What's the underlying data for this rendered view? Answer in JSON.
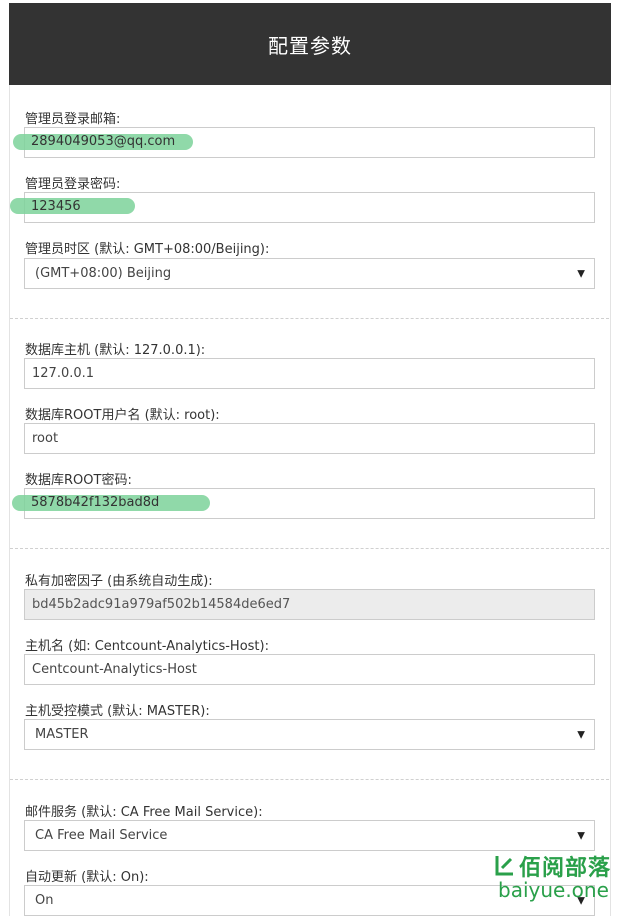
{
  "header": {
    "title": "配置参数"
  },
  "admin": {
    "email_label": "管理员登录邮箱:",
    "email_value": "2894049053@qq.com",
    "password_label": "管理员登录密码:",
    "password_value": "123456",
    "timezone_label": "管理员时区 (默认: GMT+08:00/Beijing):",
    "timezone_value": "(GMT+08:00) Beijing"
  },
  "database": {
    "host_label": "数据库主机 (默认: 127.0.0.1):",
    "host_value": "127.0.0.1",
    "user_label": "数据库ROOT用户名 (默认: root):",
    "user_value": "root",
    "password_label": "数据库ROOT密码:",
    "password_value": "5878b42f132bad8d"
  },
  "host": {
    "secret_label": "私有加密因子 (由系统自动生成):",
    "secret_value": "bd45b2adc91a979af502b14584de6ed7",
    "name_label": "主机名 (如: Centcount-Analytics-Host):",
    "name_value": "Centcount-Analytics-Host",
    "mode_label": "主机受控模式 (默认: MASTER):",
    "mode_value": "MASTER"
  },
  "mail": {
    "service_label": "邮件服务 (默认: CA Free Mail Service):",
    "service_value": "CA Free Mail Service",
    "autoupdate_label": "自动更新 (默认: On):",
    "autoupdate_value": "On"
  },
  "watermark": {
    "cn": "佰阅部落",
    "en": "baiyue.one"
  },
  "colors": {
    "header_bg": "#333333",
    "highlight": "#7dd29a",
    "watermark": "#2aa04a"
  }
}
